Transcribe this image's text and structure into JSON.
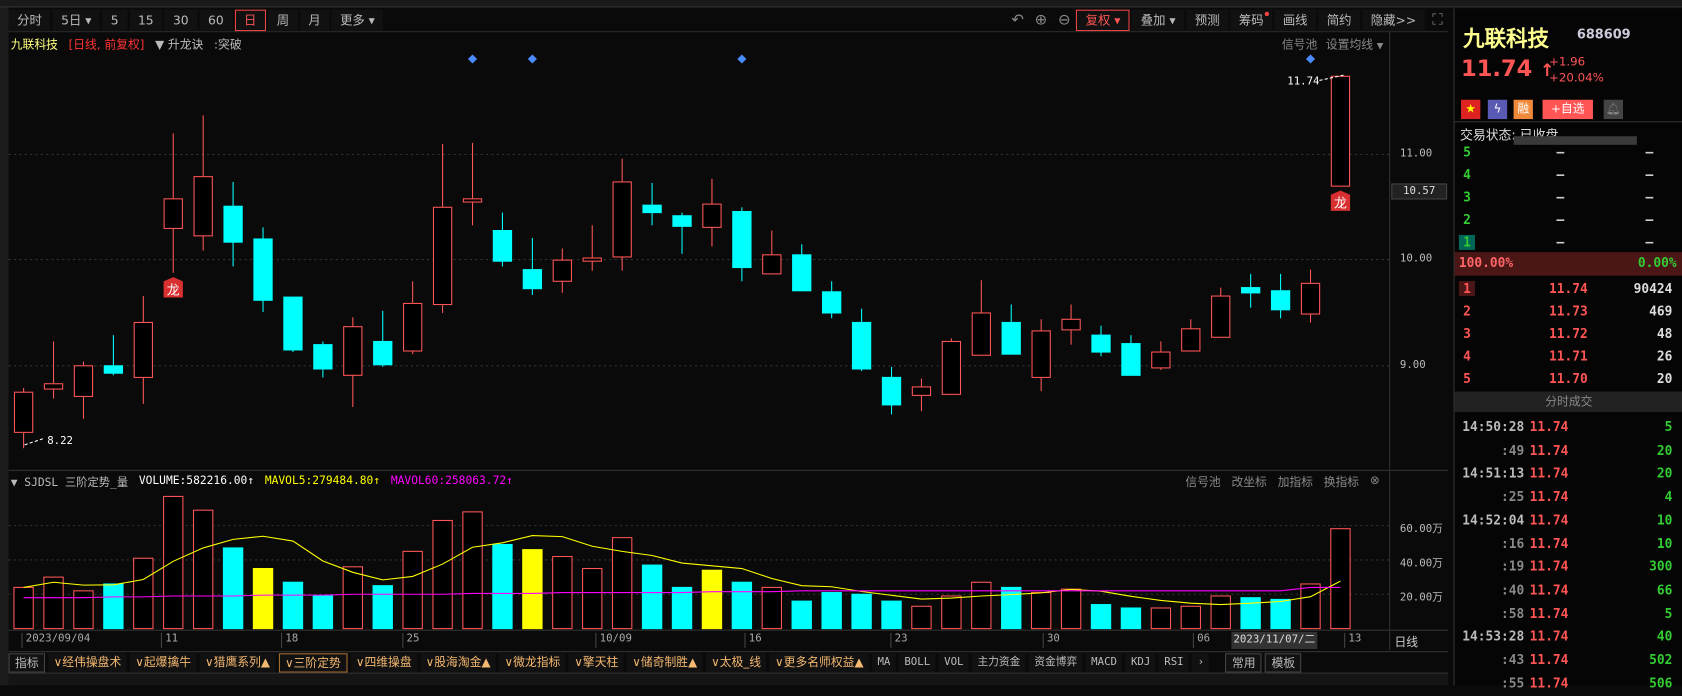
{
  "toolbar": {
    "periods": [
      "分时",
      "5日",
      "5",
      "15",
      "30",
      "60",
      "日",
      "周",
      "月",
      "更多"
    ],
    "active_period": "日",
    "right": {
      "fq": "复权",
      "overlay": "叠加",
      "forecast": "预测",
      "chips": "筹码",
      "draw": "画线",
      "simple": "简约",
      "hide": "隐藏>>"
    }
  },
  "chart_header": {
    "name": "九联科技",
    "mode": "[日线, 前复权]",
    "indicator": "升龙诀",
    "signal": ":突破",
    "signal_pool": "信号池",
    "set_ma": "设置均线"
  },
  "price_axis": {
    "labels": [
      "11.00",
      "10.00",
      "9.00"
    ],
    "highlight": "10.57"
  },
  "annotations": {
    "high_label": "11.74",
    "low_label": "8.22",
    "signal_char": "龙"
  },
  "volume_header": {
    "name": "SJDSL 三阶定势_量",
    "volume": "VOLUME:582216.00↑",
    "mavol5": "MAVOL5:279484.80↑",
    "mavol60": "MAVOL60:258063.72↑",
    "actions": [
      "信号池",
      "改坐标",
      "加指标",
      "换指标"
    ]
  },
  "volume_axis": {
    "labels": [
      "60.00万",
      "40.00万",
      "20.00万"
    ]
  },
  "date_axis": {
    "labels": [
      "2023/09/04",
      "11",
      "18",
      "25",
      "10/09",
      "16",
      "23",
      "30",
      "06",
      "13"
    ],
    "selected": "2023/11/07/二",
    "period": "日线"
  },
  "bottom_tabs": [
    "指标",
    "∨经伟操盘术",
    "∨起爆擒牛",
    "∨猎鹰系列▲",
    "∨三阶定势",
    "∨四维操盘",
    "∨股海淘金▲",
    "∨微龙指标",
    "∨擎天柱",
    "∨储奇制胜▲",
    "∨太极_线",
    "∨更多名师权益▲",
    "MA",
    "BOLL",
    "VOL",
    "主力资金",
    "资金博弈",
    "MACD",
    "KDJ",
    "RSI",
    "›",
    "常用",
    "模板"
  ],
  "quote": {
    "name": "九联科技",
    "code": "688609",
    "price": "11.74",
    "arrow": "↑",
    "change": "+1.96",
    "change_pct": "+20.04%",
    "add_watch": "+自选",
    "margin": "融",
    "status": "交易状态: 已收盘"
  },
  "order_book": {
    "asks": [
      {
        "level": "5",
        "price": "—",
        "vol": "—"
      },
      {
        "level": "4",
        "price": "—",
        "vol": "—"
      },
      {
        "level": "3",
        "price": "—",
        "vol": "—"
      },
      {
        "level": "2",
        "price": "—",
        "vol": "—"
      },
      {
        "level": "1",
        "price": "—",
        "vol": "—"
      }
    ],
    "buy_ratio": "100.00%",
    "sell_ratio": "0.00%",
    "bids": [
      {
        "level": "1",
        "price": "11.74",
        "vol": "90424"
      },
      {
        "level": "2",
        "price": "11.73",
        "vol": "469"
      },
      {
        "level": "3",
        "price": "11.72",
        "vol": "48"
      },
      {
        "level": "4",
        "price": "11.71",
        "vol": "26"
      },
      {
        "level": "5",
        "price": "11.70",
        "vol": "20"
      }
    ]
  },
  "trades_title": "分时成交",
  "trades": [
    {
      "t": "14:50:28",
      "p": "11.74",
      "v": "5"
    },
    {
      "t": ":49",
      "p": "11.74",
      "v": "20"
    },
    {
      "t": "14:51:13",
      "p": "11.74",
      "v": "20"
    },
    {
      "t": ":25",
      "p": "11.74",
      "v": "4"
    },
    {
      "t": "14:52:04",
      "p": "11.74",
      "v": "10"
    },
    {
      "t": ":16",
      "p": "11.74",
      "v": "10"
    },
    {
      "t": ":19",
      "p": "11.74",
      "v": "300"
    },
    {
      "t": ":40",
      "p": "11.74",
      "v": "66"
    },
    {
      "t": ":58",
      "p": "11.74",
      "v": "5"
    },
    {
      "t": "14:53:28",
      "p": "11.74",
      "v": "40"
    },
    {
      "t": ":43",
      "p": "11.74",
      "v": "502"
    },
    {
      "t": ":55",
      "p": "11.74",
      "v": "506"
    }
  ],
  "colors": {
    "up": "#ff5555",
    "down": "#00ffff",
    "signal": "#ffff00",
    "ma5": "#ffff00",
    "ma60": "#ff00ff",
    "diamond": "#4a8cff"
  },
  "chart_data": {
    "type": "candlestick",
    "ohlc": [
      [
        8.37,
        8.75,
        8.79,
        8.22
      ],
      [
        8.78,
        8.83,
        9.23,
        8.69
      ],
      [
        8.71,
        9.0,
        9.04,
        8.5
      ],
      [
        9.0,
        8.93,
        9.29,
        8.91
      ],
      [
        8.89,
        9.41,
        9.66,
        8.64
      ],
      [
        10.3,
        10.58,
        11.2,
        9.88
      ],
      [
        10.23,
        10.79,
        11.37,
        10.09
      ],
      [
        10.51,
        10.17,
        10.74,
        9.94
      ],
      [
        10.2,
        9.62,
        10.31,
        9.51
      ],
      [
        9.65,
        9.15,
        9.65,
        9.13
      ],
      [
        9.2,
        8.97,
        9.23,
        8.89
      ],
      [
        8.91,
        9.37,
        9.46,
        8.61
      ],
      [
        9.23,
        9.01,
        9.52,
        8.99
      ],
      [
        9.14,
        9.59,
        9.8,
        9.11
      ],
      [
        9.58,
        10.5,
        11.1,
        9.5
      ],
      [
        10.55,
        10.58,
        11.11,
        10.33
      ],
      [
        10.28,
        9.99,
        10.45,
        9.94
      ],
      [
        9.91,
        9.73,
        10.21,
        9.67
      ],
      [
        9.8,
        10.0,
        10.11,
        9.69
      ],
      [
        9.99,
        10.02,
        10.33,
        9.9
      ],
      [
        10.03,
        10.74,
        10.96,
        9.9
      ],
      [
        10.52,
        10.45,
        10.73,
        10.33
      ],
      [
        10.42,
        10.32,
        10.45,
        10.06
      ],
      [
        10.31,
        10.53,
        10.77,
        10.13
      ],
      [
        10.46,
        9.93,
        10.5,
        9.8
      ],
      [
        9.87,
        10.05,
        10.28,
        9.87
      ],
      [
        10.05,
        9.71,
        10.15,
        9.71
      ],
      [
        9.7,
        9.5,
        9.8,
        9.45
      ],
      [
        9.41,
        8.97,
        9.54,
        8.95
      ],
      [
        8.89,
        8.63,
        8.99,
        8.54
      ],
      [
        8.72,
        8.8,
        8.88,
        8.57
      ],
      [
        8.73,
        9.23,
        9.26,
        8.73
      ],
      [
        9.1,
        9.5,
        9.81,
        9.1
      ],
      [
        9.41,
        9.11,
        9.58,
        9.11
      ],
      [
        8.89,
        9.33,
        9.44,
        8.76
      ],
      [
        9.34,
        9.44,
        9.58,
        9.2
      ],
      [
        9.29,
        9.13,
        9.38,
        9.09
      ],
      [
        9.21,
        8.91,
        9.29,
        8.91
      ],
      [
        8.98,
        9.13,
        9.23,
        8.96
      ],
      [
        9.14,
        9.35,
        9.44,
        9.14
      ],
      [
        9.27,
        9.66,
        9.74,
        9.27
      ],
      [
        9.74,
        9.69,
        9.87,
        9.55
      ],
      [
        9.71,
        9.53,
        9.87,
        9.45
      ],
      [
        9.49,
        9.78,
        9.91,
        9.41
      ],
      [
        10.7,
        11.74,
        11.74,
        10.7
      ]
    ],
    "volume_wan": [
      24,
      30,
      22,
      26,
      41,
      77,
      69,
      47,
      35,
      27,
      19,
      36,
      25,
      45,
      63,
      68,
      49,
      46,
      42,
      35,
      53,
      37,
      24,
      34,
      27,
      24,
      16,
      21,
      20,
      16,
      13,
      19,
      27,
      24,
      21,
      23,
      14,
      12,
      12,
      13,
      19,
      18,
      17,
      26,
      58.2
    ],
    "volume_signal_bars": [
      8,
      17,
      23
    ],
    "mavol60_wan": [
      18,
      18,
      18,
      18.5,
      18.5,
      19,
      19,
      19,
      19.5,
      19.5,
      19.5,
      20,
      20,
      20,
      20,
      20.5,
      20.5,
      20.5,
      21,
      21,
      21,
      21,
      21,
      21.5,
      21.5,
      21.5,
      22,
      22,
      22,
      22,
      22,
      22,
      22,
      22,
      22,
      22,
      22,
      22,
      22,
      22,
      22,
      22,
      22,
      24,
      24
    ],
    "signal_diamonds": [
      15,
      17,
      24,
      43
    ],
    "dragon_signals": [
      5,
      44
    ],
    "price_range": [
      8.0,
      12.0
    ],
    "volume_range_wan": [
      0,
      80
    ]
  }
}
